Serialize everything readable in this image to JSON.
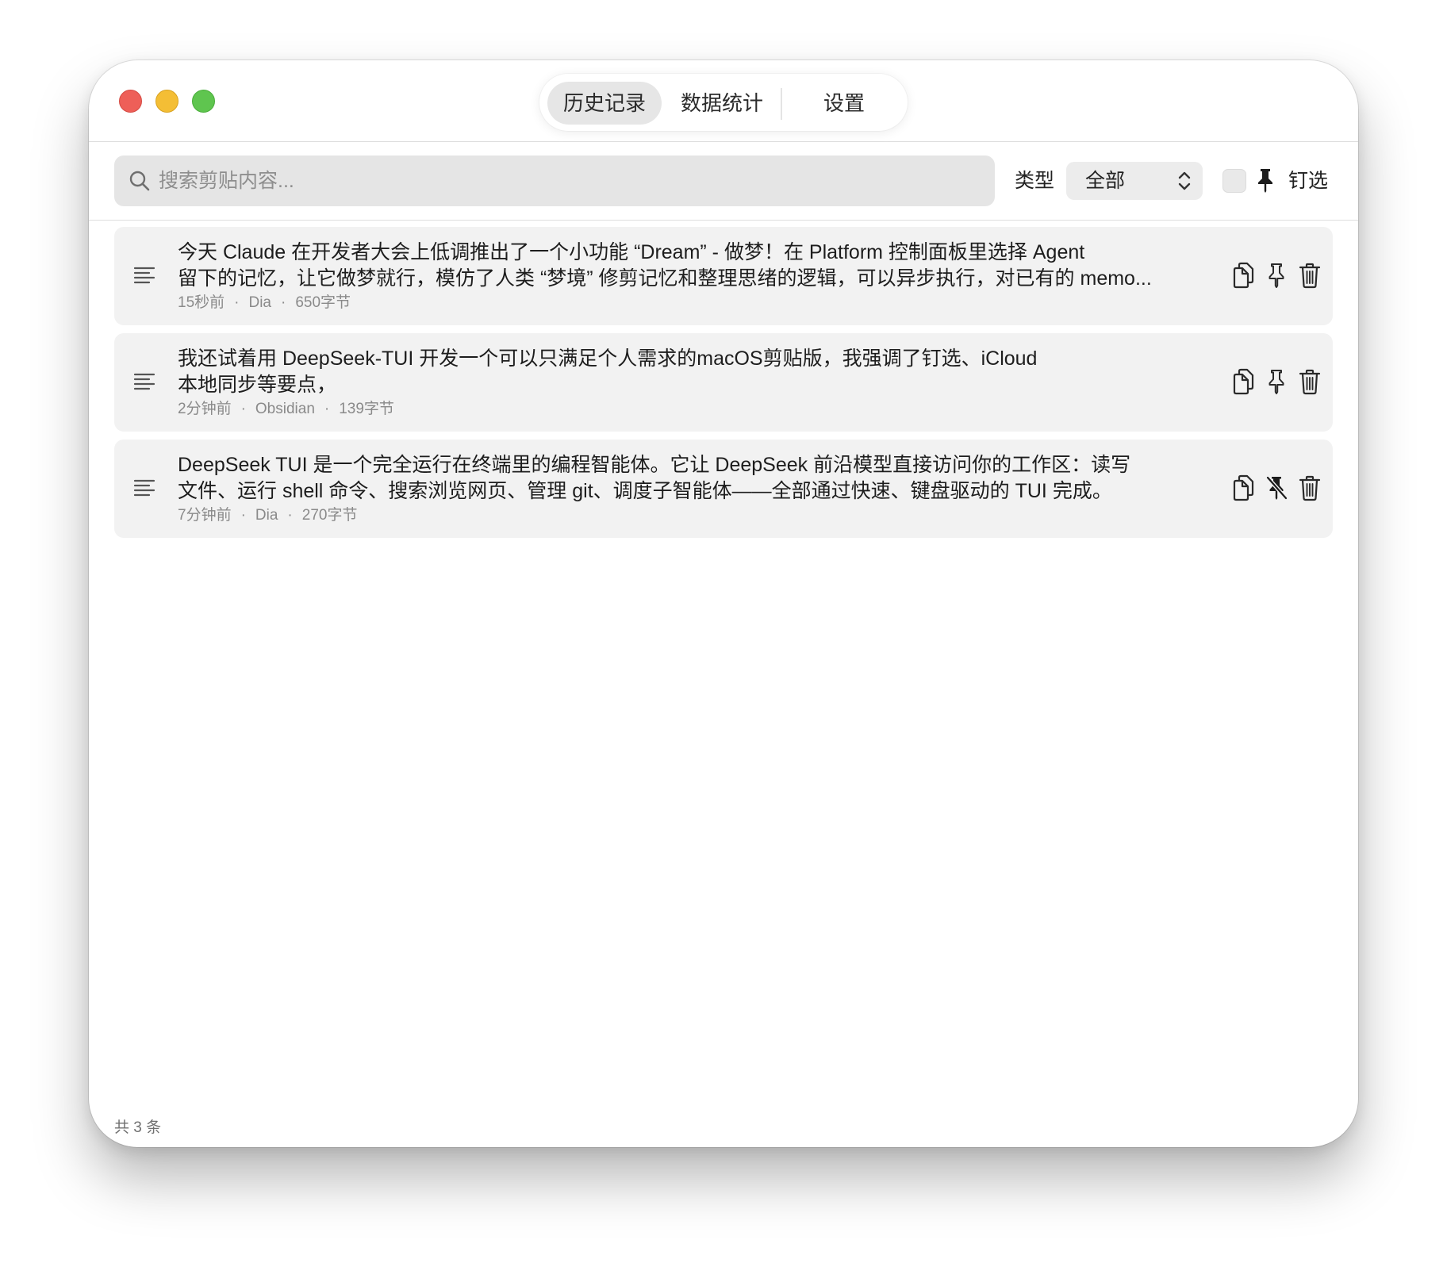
{
  "tabs": [
    {
      "label": "历史记录",
      "active": true
    },
    {
      "label": "数据统计",
      "active": false
    },
    {
      "label": "设置",
      "active": false
    }
  ],
  "toolbar": {
    "search_placeholder": "搜索剪贴内容...",
    "search_value": "",
    "type_label": "类型",
    "type_value": "全部",
    "pinned_filter_checked": false,
    "pinned_filter_label": "钉选"
  },
  "items": [
    {
      "icon": "text-lines-icon",
      "lines": [
        "今天 Claude 在开发者大会上低调推出了一个小功能 “Dream” - 做梦！在 Platform 控制面板里选择 Agent",
        "留下的记忆，让它做梦就行，模仿了人类 “梦境” 修剪记忆和整理思绪的逻辑，可以异步执行，对已有的 memo..."
      ],
      "time": "15秒前",
      "source": "Dia",
      "size": "650字节",
      "pinned": false
    },
    {
      "icon": "text-lines-icon",
      "lines": [
        "我还试着用 DeepSeek-TUI 开发一个可以只满足个人需求的macOS剪贴版，我强调了钉选、iCloud",
        "本地同步等要点，"
      ],
      "time": "2分钟前",
      "source": "Obsidian",
      "size": "139字节",
      "pinned": false
    },
    {
      "icon": "text-lines-icon",
      "lines": [
        "DeepSeek TUI 是一个完全运行在终端里的编程智能体。它让 DeepSeek 前沿模型直接访问你的工作区：读写",
        "文件、运行 shell 命令、搜索浏览网页、管理 git、调度子智能体——全部通过快速、键盘驱动的 TUI 完成。"
      ],
      "time": "7分钟前",
      "source": "Dia",
      "size": "270字节",
      "pinned": true
    }
  ],
  "meta_separator": "·",
  "footer": {
    "count_text": "共 3 条"
  },
  "colors": {
    "close": "#ee5f58",
    "minimize": "#f4be35",
    "zoom": "#5fc54f",
    "item_bg": "#f2f2f2",
    "search_bg": "#e5e5e5"
  }
}
